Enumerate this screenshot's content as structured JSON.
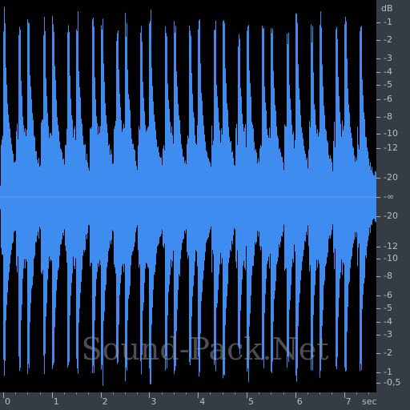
{
  "db_ruler": {
    "unit": "dB",
    "top_labels": [
      "-1",
      "-2",
      "-3",
      "-4",
      "-5",
      "-6",
      "-8",
      "-10",
      "-12",
      "-20"
    ],
    "center_label": "-∞",
    "bottom_labels": [
      "-20",
      "-12",
      "-10",
      "-8",
      "-6",
      "-5",
      "-4",
      "-3",
      "-2",
      "-1",
      "-0,5"
    ]
  },
  "time_ruler": {
    "unit": "sec",
    "labels": [
      "0",
      "1",
      "2",
      "3",
      "4",
      "5",
      "6",
      "7"
    ]
  },
  "watermark": "Sound-Pack.Net",
  "colors": {
    "waveform": "#3f8cf0",
    "background": "#000000",
    "ruler": "#363c44"
  },
  "waveform": {
    "duration_sec": 7.6,
    "hit_times_sec": [
      0.0,
      0.32,
      0.5,
      0.82,
      1.0,
      1.32,
      1.5,
      1.82,
      2.0,
      2.32,
      2.5,
      2.82,
      3.0,
      3.32,
      3.5,
      3.82,
      4.0,
      4.32,
      4.5,
      4.82,
      5.0,
      5.32,
      5.5,
      5.82,
      6.0,
      6.32,
      6.5,
      6.82,
      7.0,
      7.32
    ]
  }
}
